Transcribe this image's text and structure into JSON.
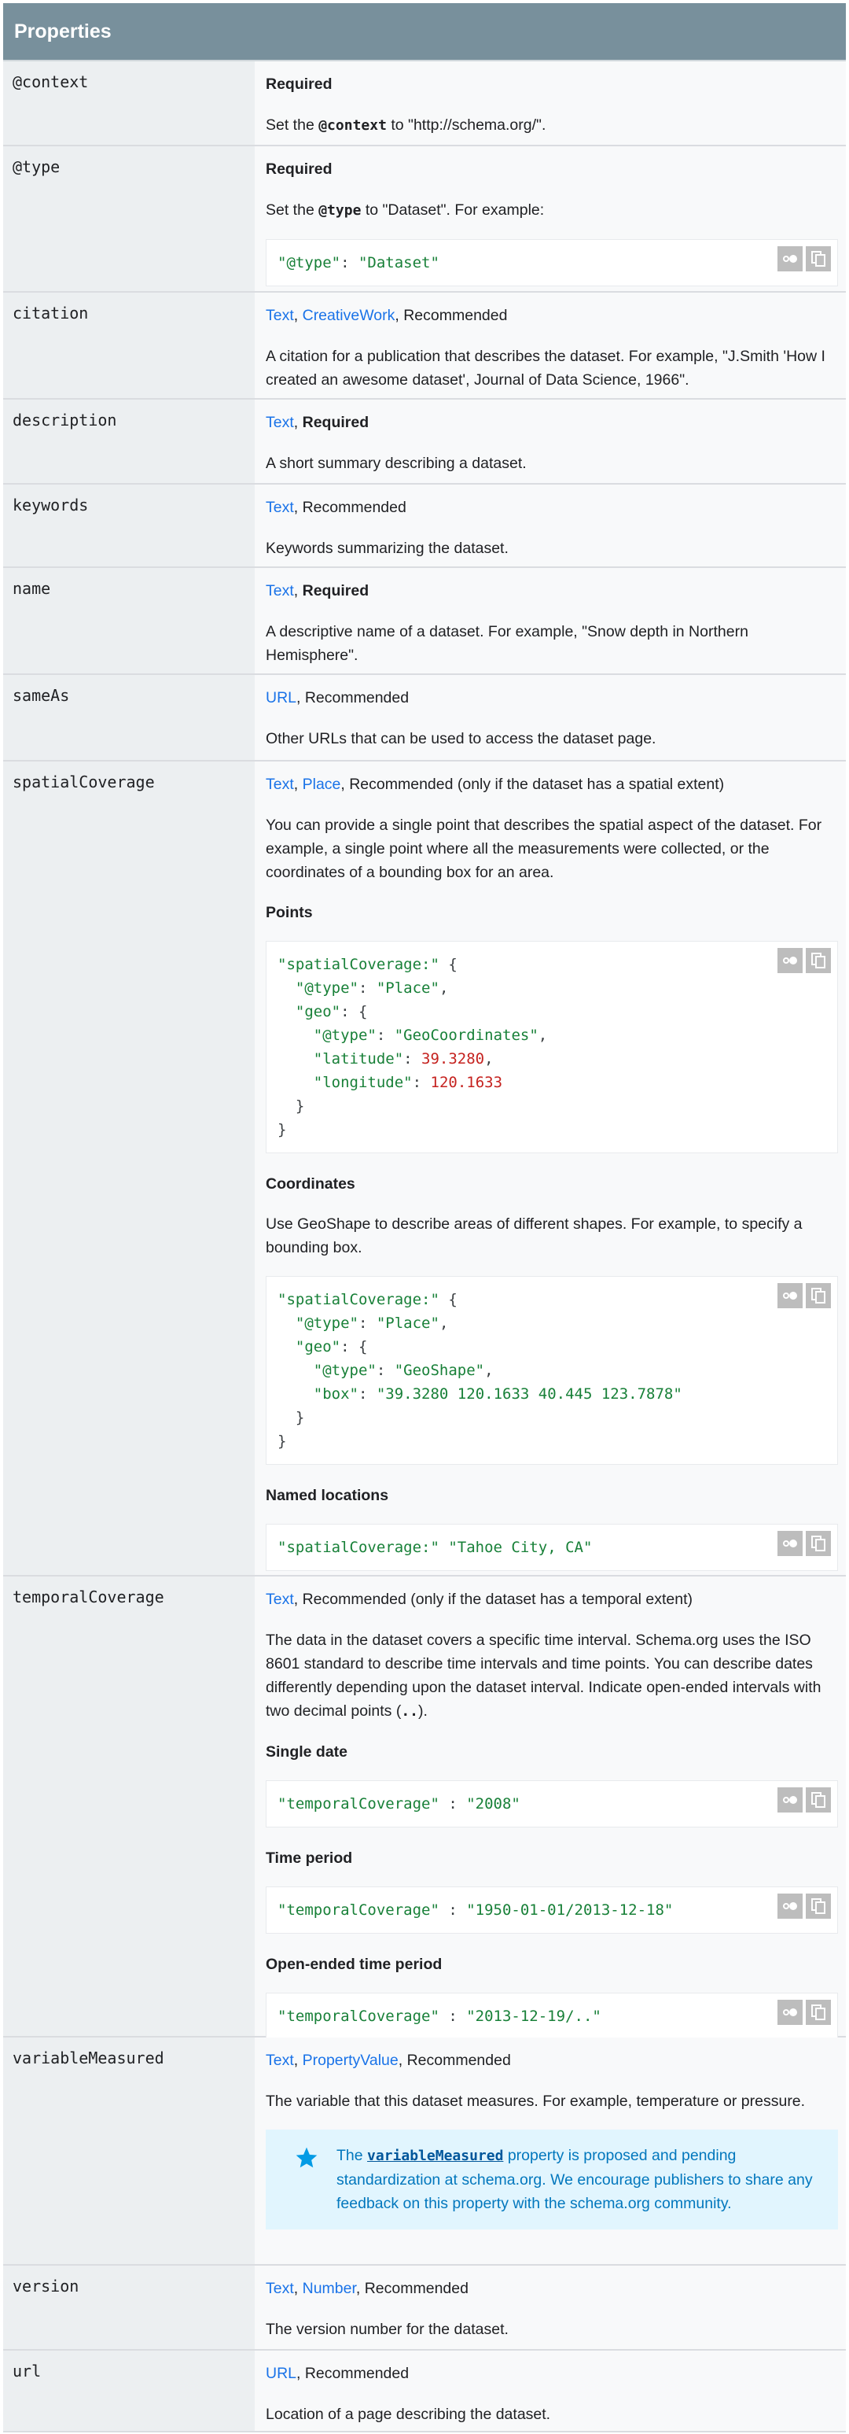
{
  "header": {
    "title": "Properties"
  },
  "rows": {
    "context": {
      "name": "@context",
      "req": "Required",
      "d1": "Set the ",
      "d1code": "@context",
      "d1end": " to \"http://schema.org/\"."
    },
    "type": {
      "name": "@type",
      "req": "Required",
      "d1": "Set the ",
      "d1code": "@type",
      "d1end": " to \"Dataset\". For example:",
      "code_key": "\"@type\"",
      "code_sep": ": ",
      "code_val": "\"Dataset\""
    },
    "citation": {
      "name": "citation",
      "t1": "Text",
      "sep1": ", ",
      "t2": "CreativeWork",
      "rest": ", Recommended",
      "desc": "A citation for a publication that describes the dataset. For example, \"J.Smith 'How I created an awesome dataset', Journal of Data Science, 1966\"."
    },
    "description": {
      "name": "description",
      "t1": "Text",
      "sep": ", ",
      "req": "Required",
      "desc": "A short summary describing a dataset."
    },
    "keywords": {
      "name": "keywords",
      "t1": "Text",
      "rest": ", Recommended",
      "desc": "Keywords summarizing the dataset."
    },
    "name": {
      "name": "name",
      "t1": "Text",
      "sep": ", ",
      "req": "Required",
      "desc": "A descriptive name of a dataset. For example, \"Snow depth in Northern Hemisphere\"."
    },
    "sameAs": {
      "name": "sameAs",
      "t1": "URL",
      "rest": ", Recommended",
      "desc": "Other URLs that can be used to access the dataset page."
    },
    "spatial": {
      "name": "spatialCoverage",
      "t1": "Text",
      "sep1": ", ",
      "t2": "Place",
      "rest": ", Recommended (only if the dataset has a spatial extent)",
      "desc": "You can provide a single point that describes the spatial aspect of the dataset. For example, a single point where all the measurements were collected, or the coordinates of a bounding box for an area.",
      "points_title": "Points",
      "coords_title": "Coordinates",
      "coords_desc": "Use GeoShape to describe areas of different shapes. For example, to specify a bounding box.",
      "named_title": "Named locations",
      "points_code": {
        "k_sc": "\"spatialCoverage:\"",
        "k_type": "\"@type\"",
        "v_place": "\"Place\"",
        "k_geo": "\"geo\"",
        "v_geocoord": "\"GeoCoordinates\"",
        "k_lat": "\"latitude\"",
        "v_lat": "39.3280",
        "k_lon": "\"longitude\"",
        "v_lon": "120.1633"
      },
      "coords_code": {
        "v_geoshape": "\"GeoShape\"",
        "k_box": "\"box\"",
        "v_box": "\"39.3280 120.1633 40.445 123.7878\""
      },
      "named_code": {
        "v_named": "\"Tahoe City, CA\""
      }
    },
    "temporal": {
      "name": "temporalCoverage",
      "t1": "Text",
      "rest": ", Recommended (only if the dataset has a temporal extent)",
      "desc": "The data in the dataset covers a specific time interval. Schema.org uses the ISO 8601 standard to describe time intervals and time points. You can describe dates differently depending upon the dataset interval. Indicate open-ended intervals with two decimal points (",
      "desc_code": "..",
      "desc_end": ").",
      "single_title": "Single date",
      "single_key": "\"temporalCoverage\"",
      "colon": " : ",
      "single_val": "\"2008\"",
      "period_title": "Time period",
      "period_val": "\"1950-01-01/2013-12-18\"",
      "open_title": "Open-ended time period",
      "open_val": "\"2013-12-19/..\""
    },
    "variable": {
      "name": "variableMeasured",
      "t1": "Text",
      "sep1": ", ",
      "t2": "PropertyValue",
      "rest": ", Recommended",
      "desc": "The variable that this dataset measures. For example, temperature or pressure.",
      "note_pre": "The ",
      "note_code": "variableMeasured",
      "note_post": " property is proposed and pending standardization at schema.org. We encourage publishers to share any feedback on this property with the schema.org community."
    },
    "version": {
      "name": "version",
      "t1": "Text",
      "sep1": ", ",
      "t2": "Number",
      "rest": ", Recommended",
      "desc": "The version number for the dataset."
    },
    "url": {
      "name": "url",
      "t1": "URL",
      "rest": ", Recommended",
      "desc": "Location of a page describing the dataset."
    }
  }
}
